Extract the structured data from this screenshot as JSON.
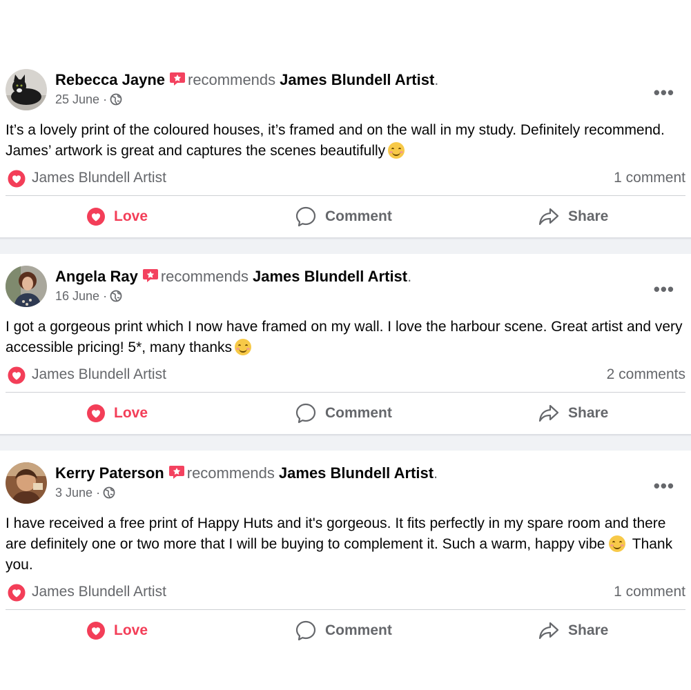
{
  "recommends_word": "recommends",
  "page_name": "James Blundell Artist",
  "page_suffix": ".",
  "date_separator": "·",
  "more_label": "•••",
  "actions": {
    "love": "Love",
    "comment": "Comment",
    "share": "Share"
  },
  "colors": {
    "love": "#f33e58",
    "muted": "#65676b",
    "badge": "#f3425f",
    "separator": "#f0f2f5"
  },
  "posts": [
    {
      "author": "Rebecca Jayne",
      "date": "25 June",
      "text": "It’s a lovely print of the coloured houses, it’s framed and on the wall in my study. Definitely recommend. James’ artwork is great and captures the scenes beautifully",
      "reaction_label": "James Blundell Artist",
      "comment_count": "1 comment"
    },
    {
      "author": "Angela Ray",
      "date": "16 June",
      "text": "I got a gorgeous print which I now have framed on my wall. I love the harbour scene. Great artist and very accessible pricing! 5*, many thanks",
      "reaction_label": "James Blundell Artist",
      "comment_count": "2 comments"
    },
    {
      "author": "Kerry Paterson",
      "date": "3 June",
      "text_part1": "I have received a free print of Happy Huts and it's gorgeous. It fits perfectly in my spare room and there are definitely one or two more that I will be buying to complement it. Such a warm, happy vibe",
      "text_part2": "Thank you.",
      "reaction_label": "James Blundell Artist",
      "comment_count": "1 comment"
    }
  ]
}
